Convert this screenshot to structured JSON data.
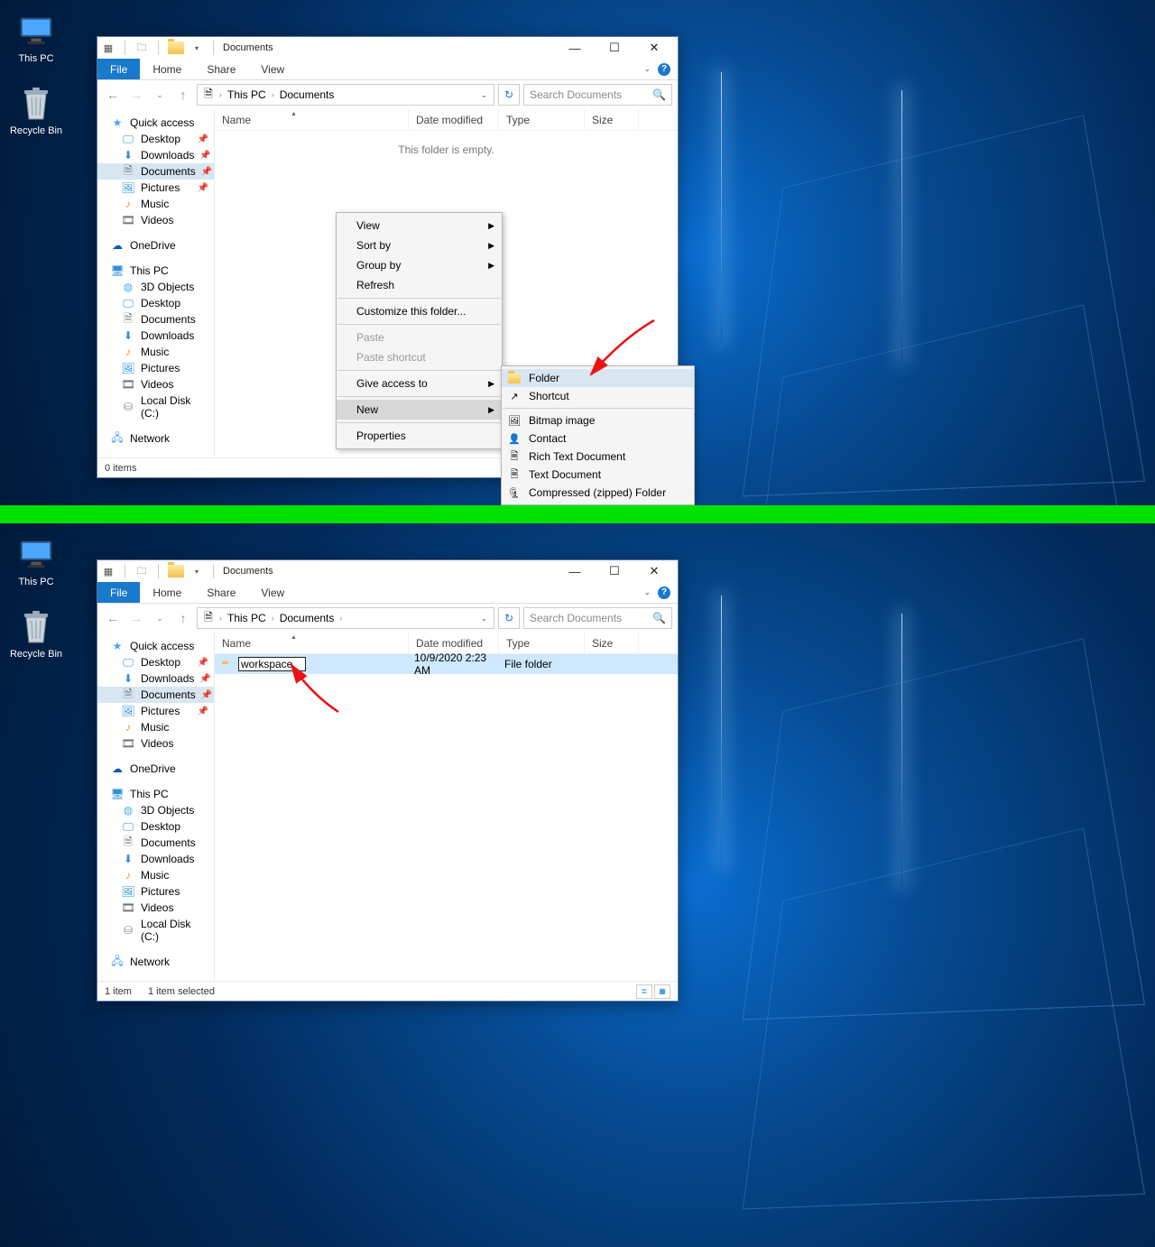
{
  "desktop": {
    "icons": [
      {
        "name": "this-pc",
        "label": "This PC"
      },
      {
        "name": "recycle-bin",
        "label": "Recycle Bin"
      }
    ]
  },
  "window": {
    "title": "Documents",
    "ribbon": {
      "file": "File",
      "home": "Home",
      "share": "Share",
      "view": "View"
    },
    "breadcrumbs": [
      "This PC",
      "Documents"
    ],
    "search_placeholder": "Search Documents",
    "columns": {
      "name": "Name",
      "date": "Date modified",
      "type": "Type",
      "size": "Size"
    },
    "empty_msg": "This folder is empty.",
    "nav": {
      "quick": "Quick access",
      "items_quick": [
        {
          "label": "Desktop",
          "pin": true,
          "icon": "desktop"
        },
        {
          "label": "Downloads",
          "pin": true,
          "icon": "dl"
        },
        {
          "label": "Documents",
          "pin": true,
          "icon": "doc",
          "sel": true
        },
        {
          "label": "Pictures",
          "pin": true,
          "icon": "pic"
        },
        {
          "label": "Music",
          "pin": false,
          "icon": "music"
        },
        {
          "label": "Videos",
          "pin": false,
          "icon": "vid"
        }
      ],
      "onedrive": "OneDrive",
      "thispc": "This PC",
      "items_pc": [
        {
          "label": "3D Objects",
          "icon": "3d"
        },
        {
          "label": "Desktop",
          "icon": "desktop"
        },
        {
          "label": "Documents",
          "icon": "doc"
        },
        {
          "label": "Downloads",
          "icon": "dl"
        },
        {
          "label": "Music",
          "icon": "music"
        },
        {
          "label": "Pictures",
          "icon": "pic"
        },
        {
          "label": "Videos",
          "icon": "vid"
        },
        {
          "label": "Local Disk (C:)",
          "icon": "disk"
        }
      ],
      "network": "Network"
    },
    "status1": "0 items"
  },
  "context": {
    "items": [
      {
        "label": "View",
        "arrow": true
      },
      {
        "label": "Sort by",
        "arrow": true
      },
      {
        "label": "Group by",
        "arrow": true
      },
      {
        "label": "Refresh"
      },
      {
        "sep": true
      },
      {
        "label": "Customize this folder..."
      },
      {
        "sep": true
      },
      {
        "label": "Paste",
        "dis": true
      },
      {
        "label": "Paste shortcut",
        "dis": true
      },
      {
        "sep": true
      },
      {
        "label": "Give access to",
        "arrow": true
      },
      {
        "sep": true
      },
      {
        "label": "New",
        "arrow": true,
        "hl": true
      },
      {
        "sep": true
      },
      {
        "label": "Properties"
      }
    ]
  },
  "submenu": {
    "items": [
      {
        "label": "Folder",
        "icon": "folder",
        "hl": true
      },
      {
        "label": "Shortcut",
        "icon": "shortcut"
      },
      {
        "sep": true
      },
      {
        "label": "Bitmap image",
        "icon": "bmp"
      },
      {
        "label": "Contact",
        "icon": "contact"
      },
      {
        "label": "Rich Text Document",
        "icon": "rtf"
      },
      {
        "label": "Text Document",
        "icon": "txt"
      },
      {
        "label": "Compressed (zipped) Folder",
        "icon": "zip"
      }
    ]
  },
  "window2": {
    "row": {
      "name_value": "workspace",
      "date": "10/9/2020 2:23 AM",
      "type": "File folder"
    },
    "status_left": "1 item",
    "status_right": "1 item selected"
  }
}
